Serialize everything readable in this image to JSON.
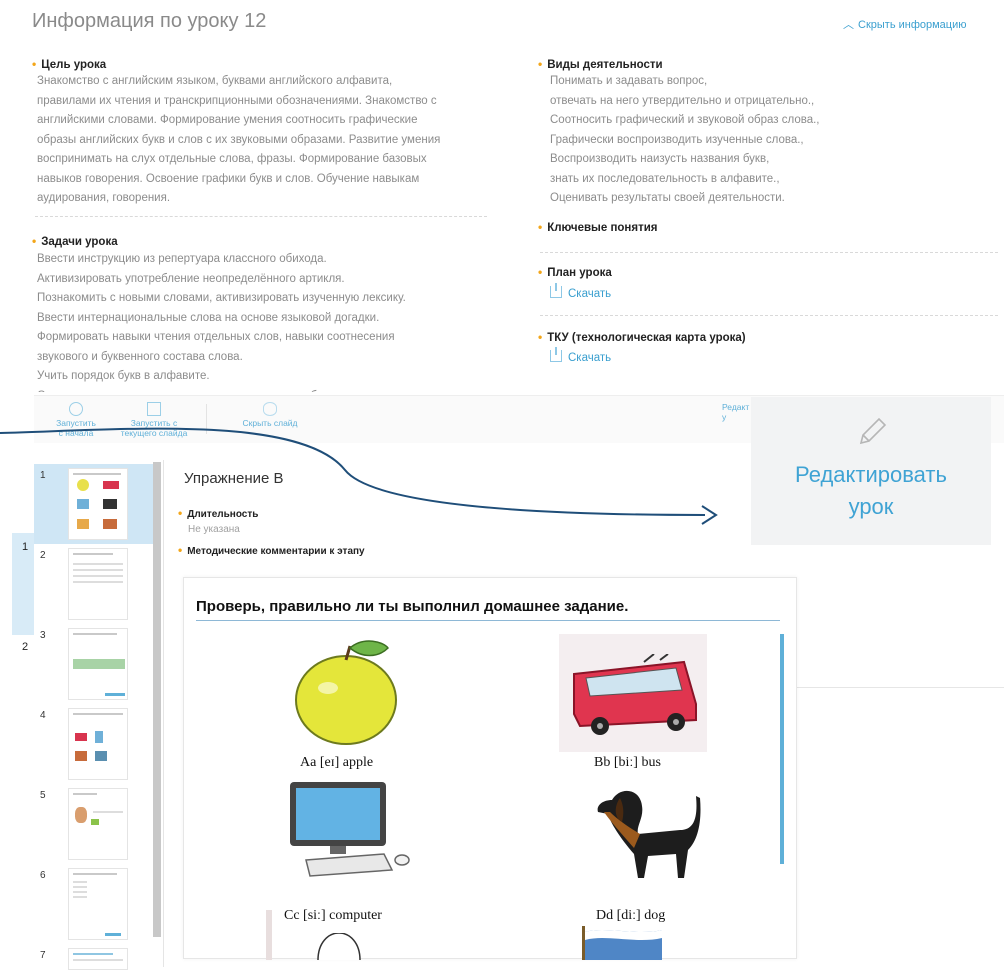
{
  "info": {
    "title": "Информация по уроку 12",
    "hide_label": "Скрыть информацию",
    "goal_heading": "Цель урока",
    "goal_text": "Знакомство с английским языком, буквами английского алфавита,\nправилами их чтения и транскрипционными обозначениями. Знакомство с\nанглийскими словами. Формирование умения соотносить графические\nобразы английских букв и слов с их звуковыми образами. Развитие умения\nвоспринимать на слух отдельные слова, фразы. Формирование базовых\nнавыков говорения. Освоение графики букв и слов. Обучение навыкам\nаудирования, говорения.",
    "tasks_heading": "Задачи урока",
    "tasks_text": "Ввести инструкцию из репертуара классного обихода.\nАктивизировать употребление неопределённого артикля.\nПознакомить с новыми словами, активизировать изученную лексику.\nВвести интернациональные слова на основе языковой догадки.\nФормировать навыки чтения отдельных слов, навыки соотнесения\nзвукового и буквенного состава слова.\nУчить порядок букв в алфавите.\nСистематизировать полученные знания о звуках и буквах.",
    "activities_heading": "Виды деятельности",
    "activities_text": "Понимать и задавать вопрос,\nотвечать на него утвердительно и отрицательно.,\nСоотносить графический и звуковой образ слова.,\nГрафически воспроизводить изученные слова.,\nВоспроизводить наизусть названия букв,\nзнать их последовательность в алфавите.,\nОценивать результаты своей деятельности.",
    "key_concepts_heading": "Ключевые понятия",
    "plan_heading": "План урока",
    "plan_download": "Скачать",
    "tku_heading": "ТКУ (технологическая карта урока)",
    "tku_download": "Скачать"
  },
  "toolbar": {
    "start_from_beginning": "Запустить\nс начала",
    "start_from_current": "Запустить с\nтекущего слайда",
    "hide_slide": "Скрыть слайд",
    "edit_partial": "Редакт\nу"
  },
  "callout": {
    "edit_lesson": "Редактировать\nурок"
  },
  "side_numbers": [
    "1",
    "2"
  ],
  "thumbnails": [
    "1",
    "2",
    "3",
    "4",
    "5",
    "6",
    "7"
  ],
  "stage": {
    "title": "Упражнение В",
    "duration_heading": "Длительность",
    "duration_value": "Не указана",
    "method_heading": "Методические комментарии к этапу"
  },
  "slide": {
    "question": "Проверь, правильно ли ты выполнил домашнее задание.",
    "items": [
      {
        "caption": "Aa [eɪ] apple",
        "icon": "apple-image"
      },
      {
        "caption": "Bb [biː] bus",
        "icon": "bus-image"
      },
      {
        "caption": "Cc [siː] computer",
        "icon": "computer-image"
      },
      {
        "caption": "Dd [diː] dog",
        "icon": "dog-image"
      }
    ]
  },
  "colors": {
    "accent": "#3a9fcf",
    "bullet": "#f3a61a",
    "callout_bg": "#f2f3f4",
    "active_thumb": "#cfe6f5",
    "arrow": "#1f4e79"
  }
}
